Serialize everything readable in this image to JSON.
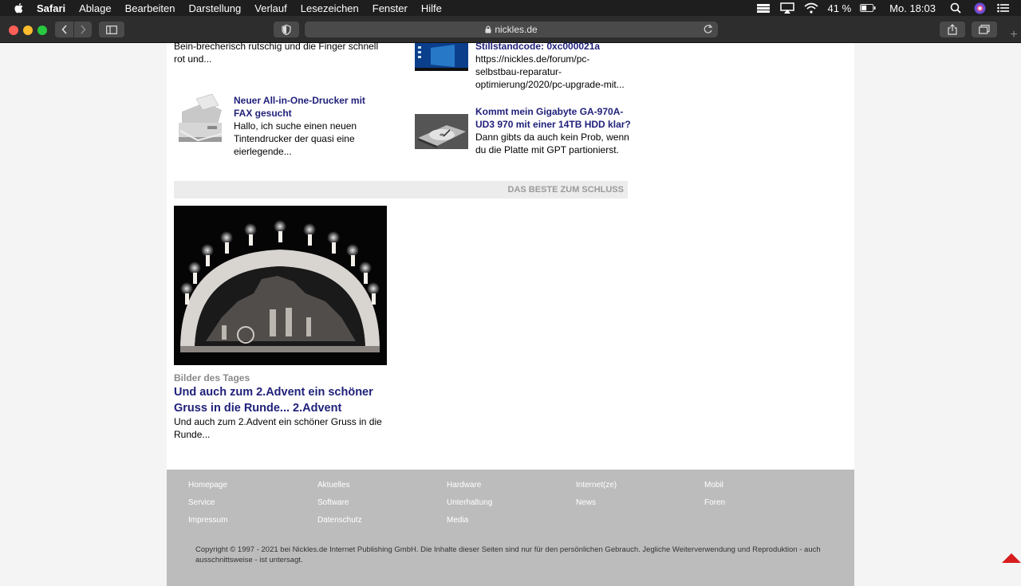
{
  "menubar": {
    "app": "Safari",
    "items": [
      "Ablage",
      "Bearbeiten",
      "Darstellung",
      "Verlauf",
      "Lesezeichen",
      "Fenster",
      "Hilfe"
    ],
    "battery": "41 %",
    "clock": "Mo. 18:03"
  },
  "toolbar": {
    "url": "nickles.de"
  },
  "articles": [
    {
      "title": "",
      "text": "Bein-brecherisch rutschig und die Finger schnell rot und..."
    },
    {
      "title": "Stillstandcode: 0xc000021a",
      "text": "https://nickles.de/forum/pc-selbstbau-reparatur-optimierung/2020/pc-upgrade-mit..."
    },
    {
      "title": "Neuer All-in-One-Drucker mit FAX gesucht",
      "text": "Hallo, ich suche einen neuen Tintendrucker der quasi eine eierlegende..."
    },
    {
      "title": "Kommt mein Gigabyte GA-970A-UD3 970 mit einer 14TB HDD klar?",
      "text": "Dann gibts da auch kein Prob, wenn du die Platte mit GPT partionierst."
    }
  ],
  "section": {
    "heading": "DAS BESTE ZUM SCHLUSS"
  },
  "feature": {
    "category": "Bilder des Tages",
    "title": "Und auch zum 2.Advent ein schöner Gruss in die Runde... 2.Advent",
    "text": "Und auch zum 2.Advent ein schöner Gruss in die Runde..."
  },
  "footer": {
    "links": [
      [
        "Homepage",
        "Aktuelles",
        "Hardware",
        "Internet(ze)",
        "Mobil"
      ],
      [
        "Service",
        "Software",
        "Unterhaltung",
        "News",
        "Foren"
      ],
      [
        "Impressum",
        "Datenschutz",
        "Media"
      ]
    ],
    "copyright": "Copyright © 1997 - 2021 bei Nickles.de Internet Publishing GmbH. Die Inhalte dieser Seiten sind nur für den persönlichen Gebrauch. Jegliche Weiterverwendung und Reproduktion - auch ausschnittsweise - ist untersagt."
  },
  "colors": {
    "link": "#1f1f7a",
    "footer_bg": "#bcbcbc",
    "scroll_top": "#d61c1c"
  }
}
